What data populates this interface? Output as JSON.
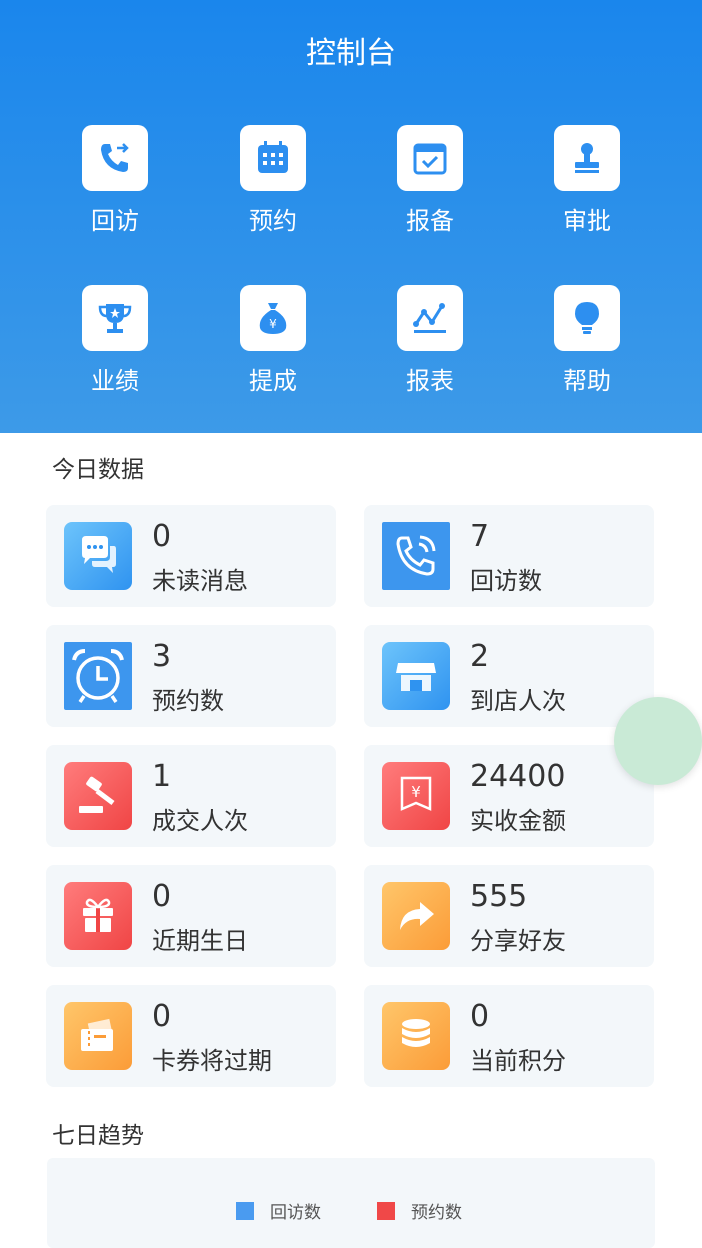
{
  "header": {
    "title": "控制台"
  },
  "quick_actions": [
    {
      "label": "回访",
      "icon": "phone-callback-icon"
    },
    {
      "label": "预约",
      "icon": "calendar-grid-icon"
    },
    {
      "label": "报备",
      "icon": "calendar-check-icon"
    },
    {
      "label": "审批",
      "icon": "stamp-icon"
    },
    {
      "label": "业绩",
      "icon": "trophy-icon"
    },
    {
      "label": "提成",
      "icon": "money-bag-icon"
    },
    {
      "label": "报表",
      "icon": "line-chart-icon"
    },
    {
      "label": "帮助",
      "icon": "lightbulb-icon"
    }
  ],
  "today": {
    "title": "今日数据",
    "cards": [
      {
        "value": "0",
        "label": "未读消息",
        "icon": "chat-bubbles-icon"
      },
      {
        "value": "7",
        "label": "回访数",
        "icon": "phone-ringing-icon"
      },
      {
        "value": "3",
        "label": "预约数",
        "icon": "alarm-clock-icon"
      },
      {
        "value": "2",
        "label": "到店人次",
        "icon": "store-icon"
      },
      {
        "value": "1",
        "label": "成交人次",
        "icon": "gavel-icon"
      },
      {
        "value": "24400",
        "label": "实收金额",
        "icon": "yuan-receipt-icon"
      },
      {
        "value": "0",
        "label": "近期生日",
        "icon": "gift-icon"
      },
      {
        "value": "555",
        "label": "分享好友",
        "icon": "share-arrow-icon"
      },
      {
        "value": "0",
        "label": "卡券将过期",
        "icon": "ticket-icon"
      },
      {
        "value": "0",
        "label": "当前积分",
        "icon": "coin-stack-icon"
      }
    ]
  },
  "trend": {
    "title": "七日趋势",
    "legend": [
      {
        "label": "回访数",
        "color": "#4a9bf0"
      },
      {
        "label": "预约数",
        "color": "#f04848"
      }
    ]
  },
  "colors": {
    "header_blue": "#1a86ec",
    "icon_blue": "#2d8ff0",
    "card_bg": "#f3f7fa"
  }
}
